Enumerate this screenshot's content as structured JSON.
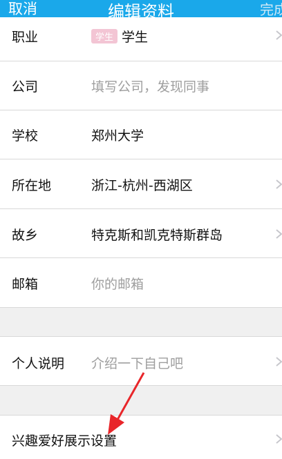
{
  "header": {
    "cancel": "取消",
    "title": "编辑资料",
    "done": "完成"
  },
  "rows": [
    {
      "label": "职业",
      "badge": "学生",
      "value": "学生"
    },
    {
      "label": "公司",
      "placeholder": "填写公司，发现同事"
    },
    {
      "label": "学校",
      "value": "郑州大学"
    },
    {
      "label": "所在地",
      "value": "浙江-杭州-西湖区"
    },
    {
      "label": "故乡",
      "value": "特克斯和凯克特斯群岛"
    },
    {
      "label": "邮箱",
      "placeholder": "你的邮箱"
    },
    {
      "label": "个人说明",
      "placeholder": "介绍一下自己吧"
    },
    {
      "label": "兴趣爱好展示设置"
    }
  ],
  "colors": {
    "header": "#1aa8ea",
    "annotation_arrow": "#e8262a"
  },
  "icons": {
    "chevron": "chevron-right-icon",
    "annotation": "red-arrow-icon"
  }
}
